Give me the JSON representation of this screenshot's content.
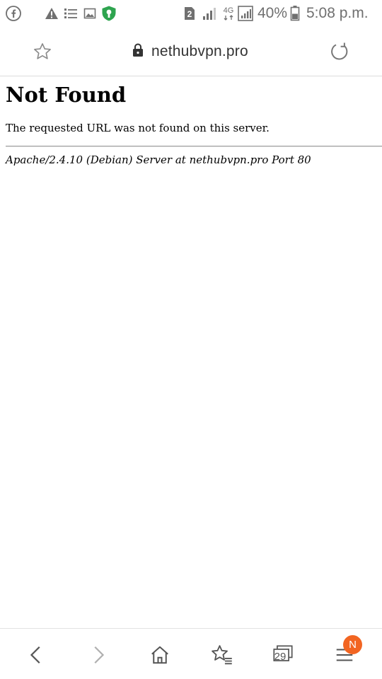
{
  "status_bar": {
    "left_icons": [
      "facebook-icon",
      "warning-icon",
      "list-icon",
      "image-icon",
      "vpn-shield-icon"
    ],
    "right_icons": [
      "sim2-icon",
      "signal-icon",
      "network-4g-icon",
      "signal-icon",
      "battery-icon"
    ],
    "network_type": "4G",
    "battery_percent": "40%",
    "time": "5:08 p.m."
  },
  "browser": {
    "url": "nethubvpn.pro",
    "bookmark_icon": "star-outline-icon",
    "secure_icon": "lock-icon",
    "reload_icon": "reload-icon"
  },
  "page": {
    "heading": "Not Found",
    "message": "The requested URL was not found on this server.",
    "server_signature": "Apache/2.4.10 (Debian) Server at nethubvpn.pro Port 80"
  },
  "bottom_nav": {
    "items": [
      "back-icon",
      "forward-icon",
      "home-icon",
      "bookmarks-icon",
      "tabs-icon",
      "menu-icon"
    ],
    "tabs_count": "29",
    "notification_badge": "N",
    "badge_color": "#f26522"
  }
}
